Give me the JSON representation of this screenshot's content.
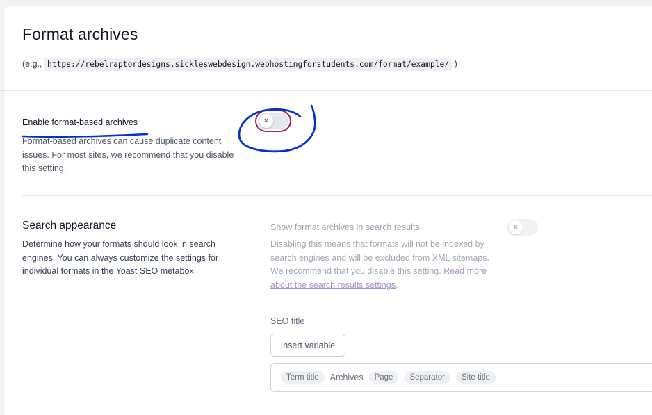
{
  "header": {
    "title": "Format archives",
    "example_prefix": "(e.g.,",
    "example_url": "https://rebelraptordesigns.sickleswebdesign.webhostingforstudents.com/format/example/",
    "example_suffix": ")"
  },
  "enable_archives": {
    "label": "Enable format-based archives",
    "description": "Format-based archives can cause duplicate content issues. For most sites, we recommend that you disable this setting.",
    "toggle_enabled": false,
    "toggle_knob_symbol": "×"
  },
  "search_appearance": {
    "title": "Search appearance",
    "description": "Determine how your formats should look in search engines. You can always customize the settings for individual formats in the Yoast SEO metabox.",
    "show_label": "Show format archives in search results",
    "show_description": "Disabling this means that formats will not be indexed by search engines and will be excluded from XML sitemaps. We recommend that you disable this setting.",
    "read_more_link": "Read more about the search results settings",
    "show_toggle_enabled": false,
    "toggle_knob_symbol": "×",
    "seo_title_label": "SEO title",
    "insert_variable_label": "Insert variable",
    "seo_title_parts": [
      {
        "type": "chip",
        "text": "Term title"
      },
      {
        "type": "text",
        "text": "Archives"
      },
      {
        "type": "chip",
        "text": "Page"
      },
      {
        "type": "chip",
        "text": "Separator"
      },
      {
        "type": "chip",
        "text": "Site title"
      }
    ]
  },
  "colors": {
    "accent_focus": "#a61e69",
    "annotation": "#0033cc"
  }
}
